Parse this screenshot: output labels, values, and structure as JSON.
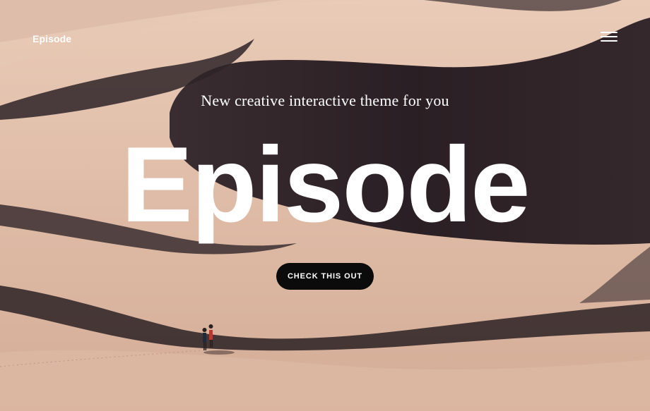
{
  "header": {
    "logo_text": "Episode",
    "menu_icon": "hamburger-menu-icon"
  },
  "hero": {
    "tagline": "New creative interactive theme for you",
    "headline": "Episode",
    "cta_label": "CHECK THIS OUT"
  },
  "colors": {
    "text": "#ffffff",
    "button_bg": "#0b0b0b",
    "sand_light": "#e4c4b0",
    "dune_shadow": "#2a2024"
  }
}
